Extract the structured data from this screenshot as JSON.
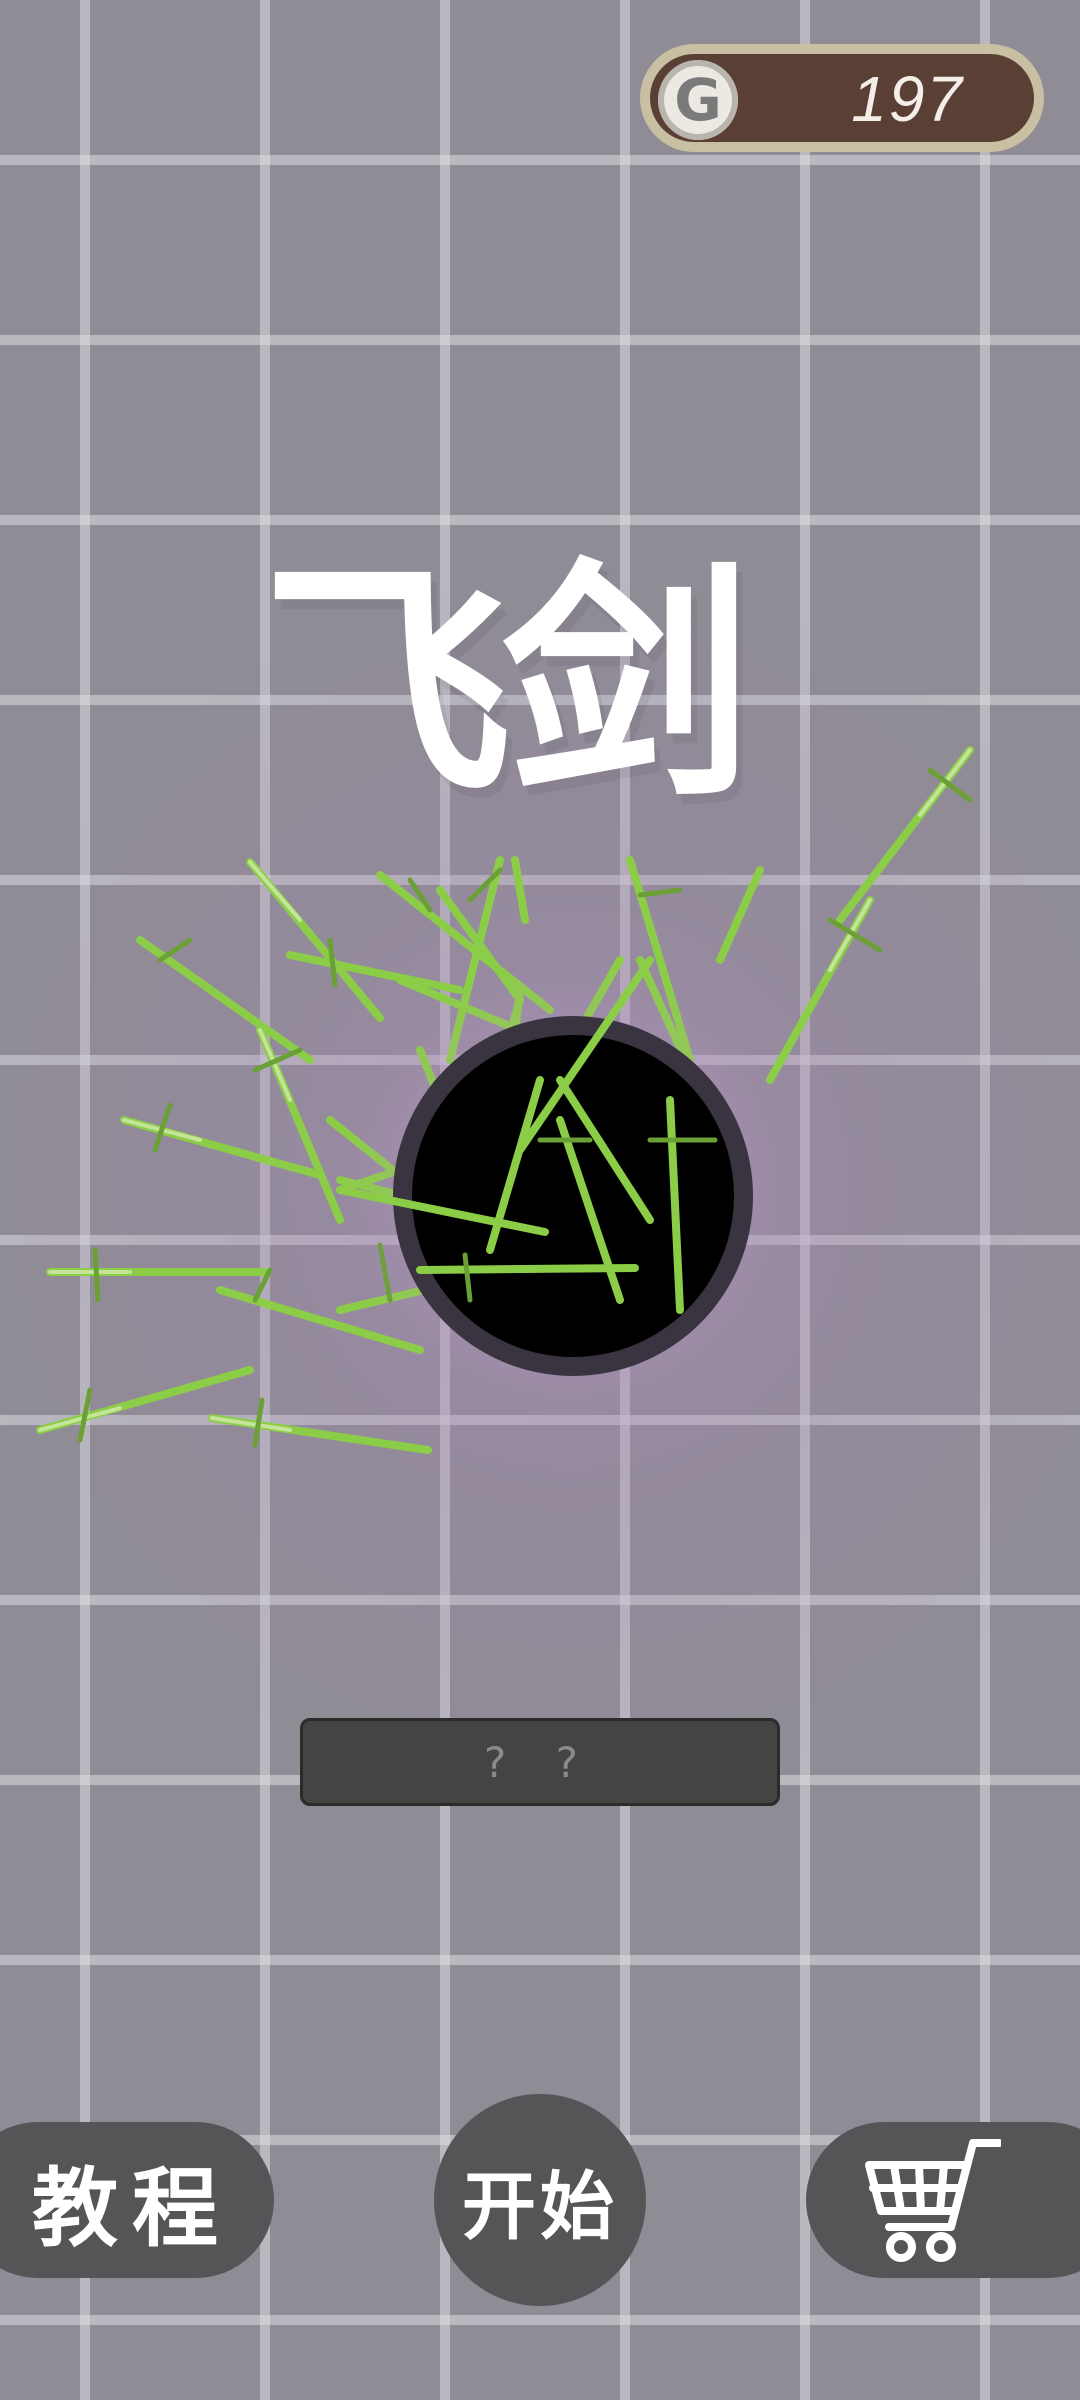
{
  "coins": {
    "icon_letter": "G",
    "count": "197"
  },
  "game_title": "飞剑",
  "player_name": "? ?",
  "buttons": {
    "tutorial": "教程",
    "start": "开始",
    "shop_icon": "cart-icon"
  },
  "colors": {
    "background": "#8f8c95",
    "sword_blade": "#8fd04a",
    "coin_pill": "#5a3f35",
    "button": "#555456"
  }
}
